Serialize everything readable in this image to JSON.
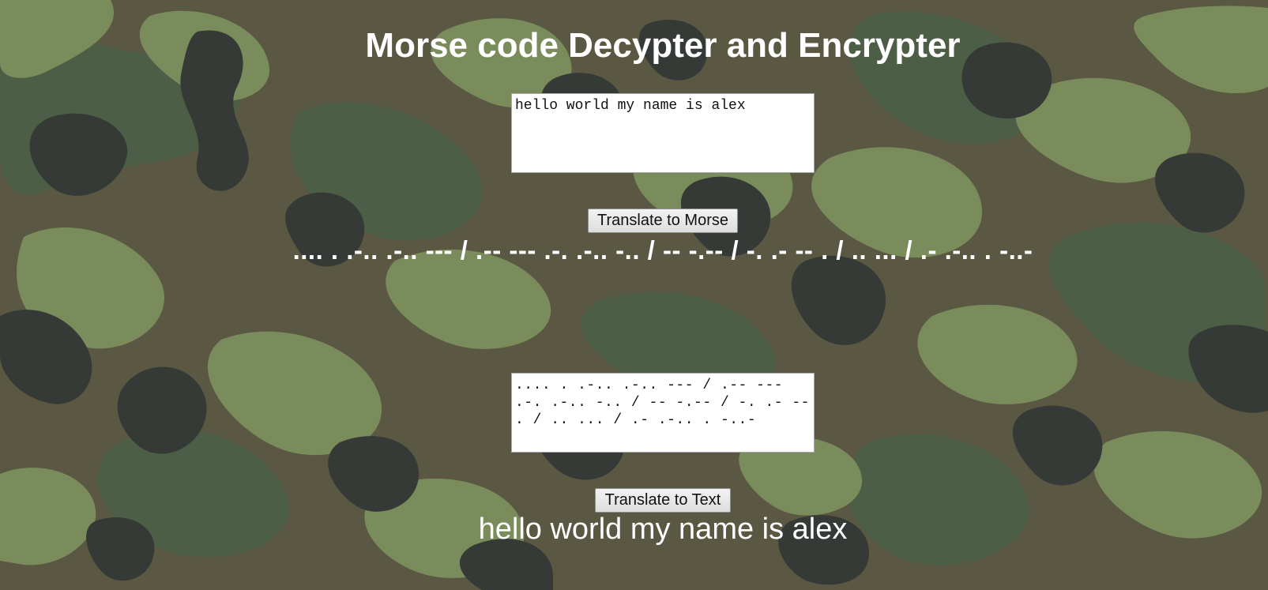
{
  "page": {
    "title": "Morse code Decypter and Encrypter"
  },
  "encrypt": {
    "input_value": "hello world my name is alex",
    "button_label": "Translate to Morse",
    "output_text": ".... . .-.. .-.. --- / .-- --- .-. .-.. -.. / -- -.-- / -. .- -- . / .. ... / .- .-.. . -..-"
  },
  "decrypt": {
    "input_value": ".... . .-.. .-.. --- / .-- --- .-. .-.. -.. / -- -.-- / -. .- -- . / .. ... / .- .-.. . -..-",
    "button_label": "Translate to Text",
    "output_text": "hello world my name is alex"
  },
  "colors": {
    "camo_base": "#5a5842",
    "camo_dark": "#353a36",
    "camo_green": "#4c5e45",
    "camo_light": "#7b8c5c",
    "text": "#ffffff"
  }
}
